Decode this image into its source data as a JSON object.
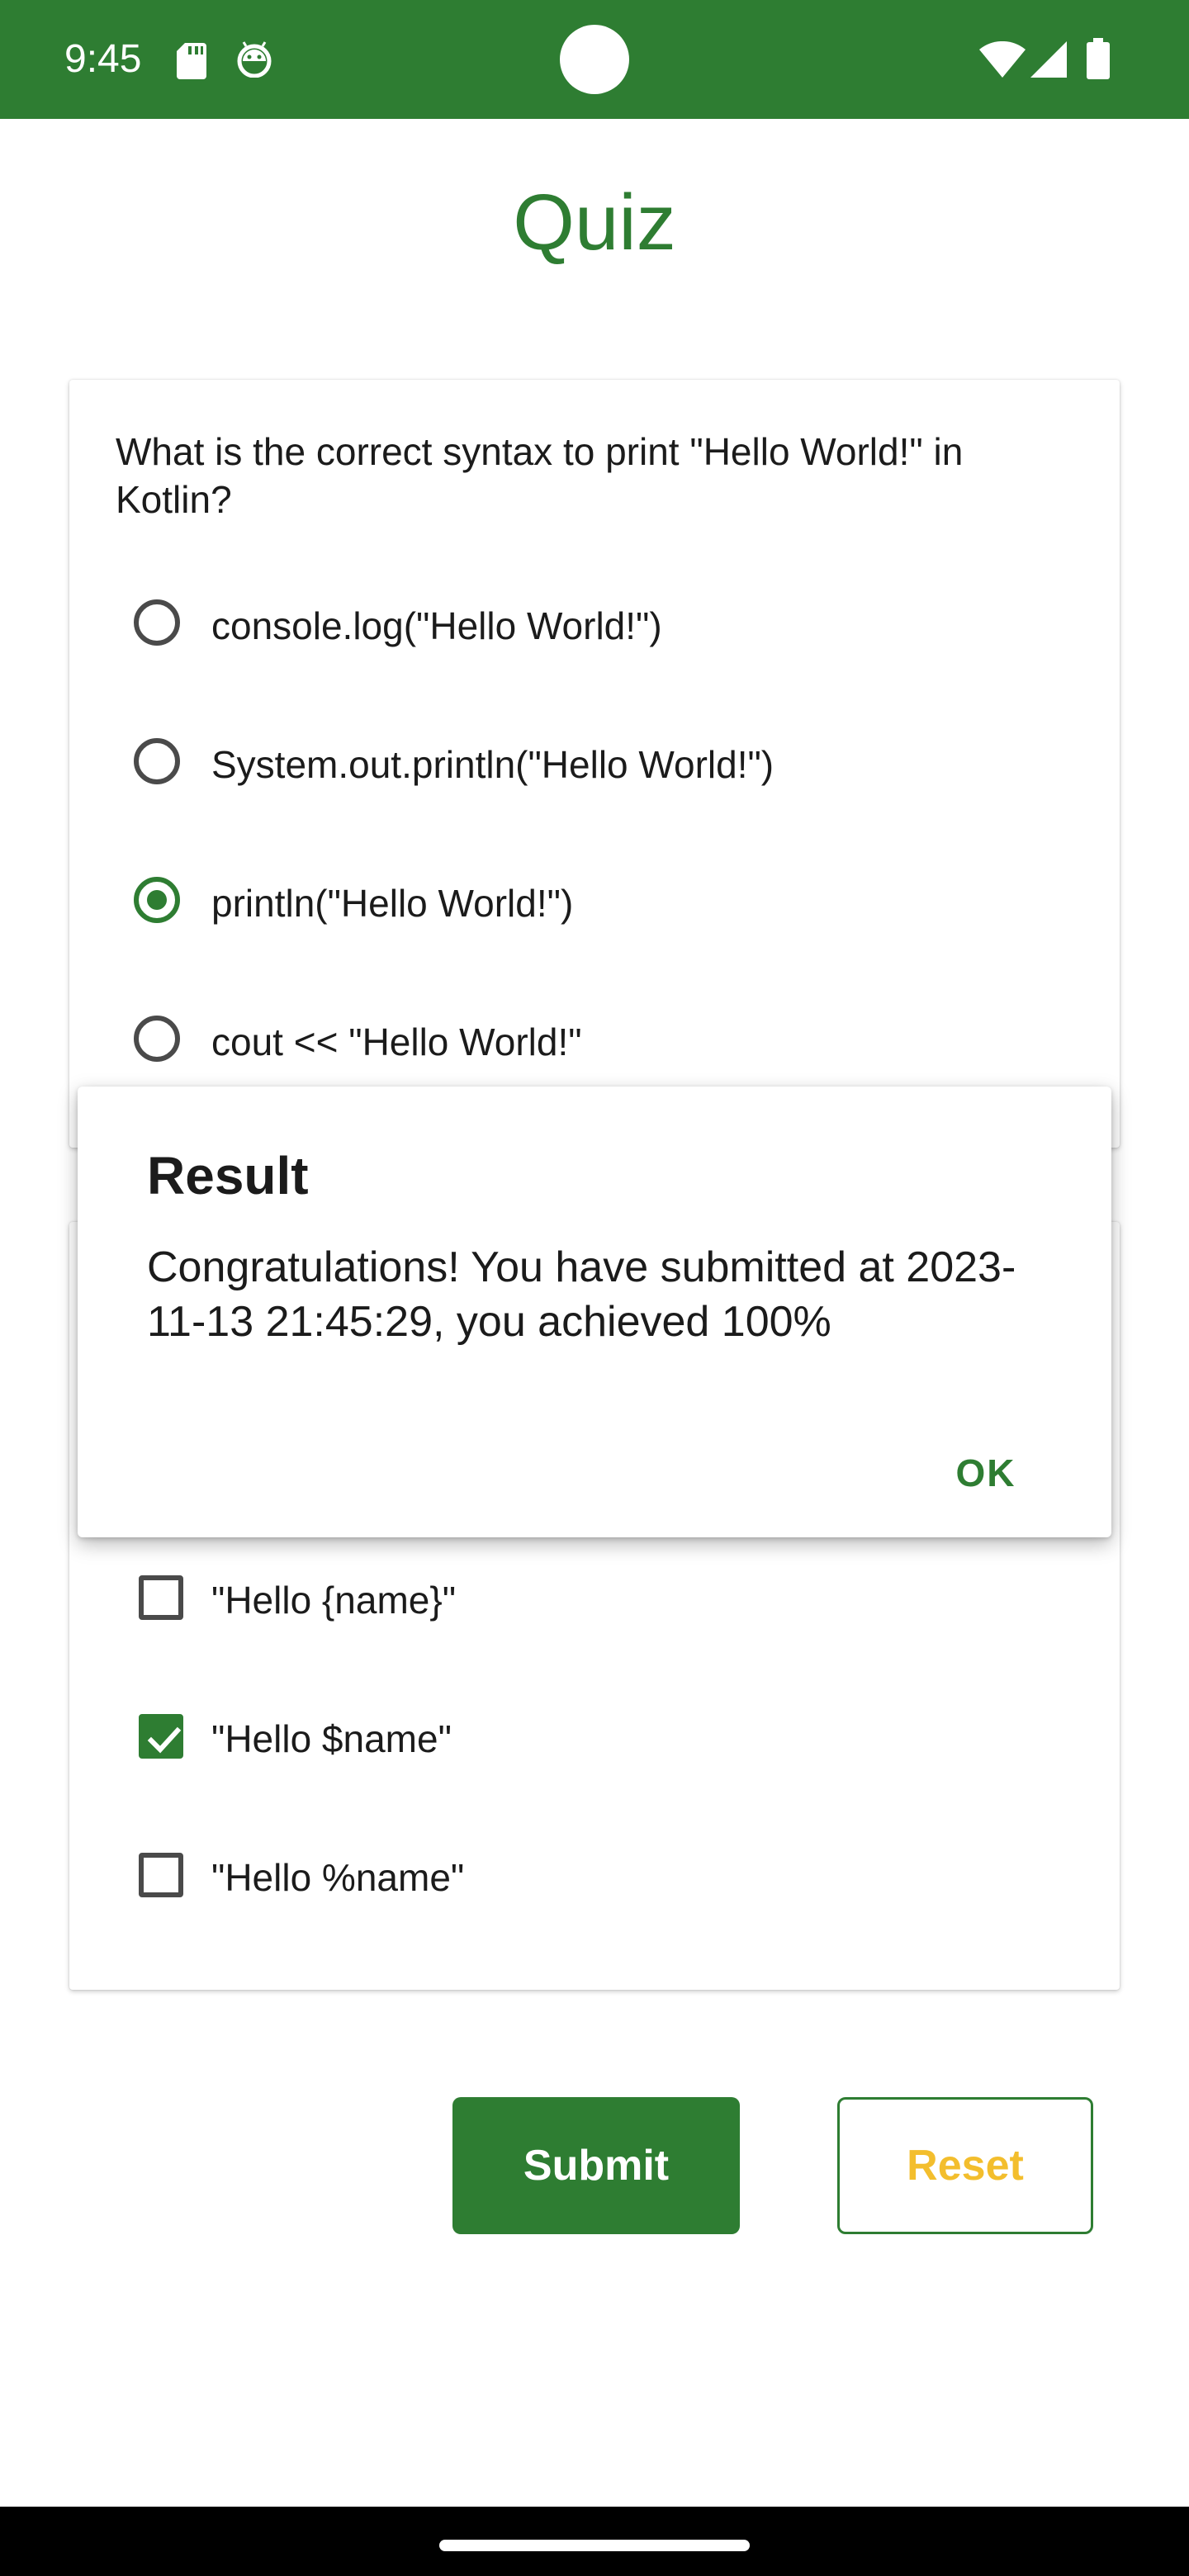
{
  "status_bar": {
    "time": "9:45",
    "background_color": "#2e7d32",
    "icons": [
      "sd-card-icon",
      "android-debug-icon",
      "wifi-icon",
      "cell-signal-icon",
      "battery-icon"
    ]
  },
  "title": "Quiz",
  "question1": {
    "text": "What is the correct syntax to print \"Hello World!\" in Kotlin?",
    "options": [
      {
        "label": "console.log(\"Hello World!\")",
        "selected": false
      },
      {
        "label": "System.out.println(\"Hello World!\")",
        "selected": false
      },
      {
        "label": "println(\"Hello World!\")",
        "selected": true
      },
      {
        "label": "cout << \"Hello World!\"",
        "selected": false
      }
    ]
  },
  "question2": {
    "options": [
      {
        "label": "\"Hello {name}\"",
        "checked": false
      },
      {
        "label": "\"Hello $name\"",
        "checked": true
      },
      {
        "label": "\"Hello %name\"",
        "checked": false
      }
    ]
  },
  "buttons": {
    "submit": "Submit",
    "reset": "Reset"
  },
  "dialog": {
    "title": "Result",
    "message": "Congratulations! You have submitted at 2023-11-13 21:45:29, you achieved 100%",
    "ok": "OK"
  },
  "colors": {
    "primary": "#2e7d32",
    "reset_text": "#f3be2d"
  }
}
